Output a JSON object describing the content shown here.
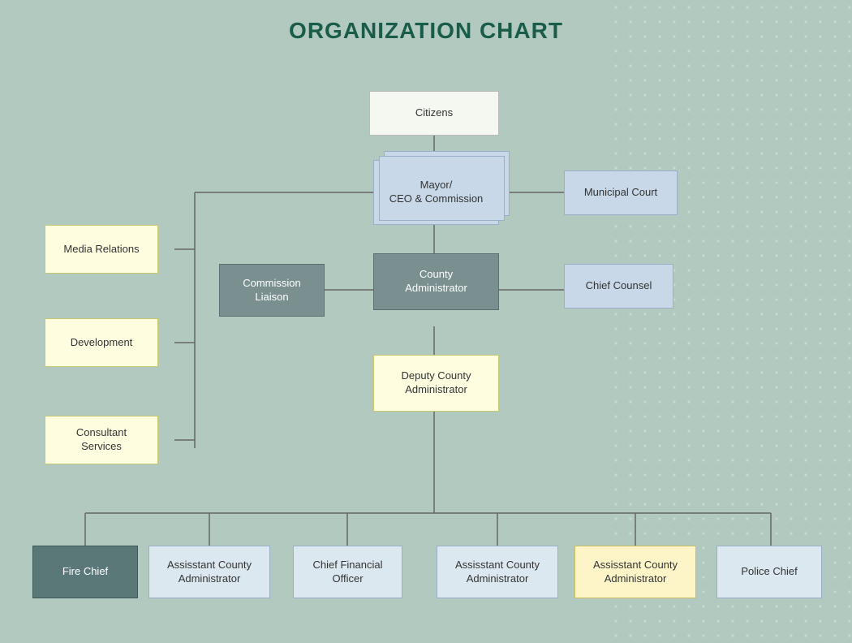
{
  "title": "ORGANIZATION CHART",
  "boxes": {
    "citizens": {
      "label": "Citizens"
    },
    "mayor": {
      "label": "Mayor/\nCEO & Commission"
    },
    "municipal_court": {
      "label": "Municipal Court"
    },
    "media_relations": {
      "label": "Media Relations"
    },
    "development": {
      "label": "Development"
    },
    "consultant_services": {
      "label": "Consultant\nServices"
    },
    "commission_liaison": {
      "label": "Commission\nLiaison"
    },
    "county_administrator": {
      "label": "County\nAdministrator"
    },
    "chief_counsel": {
      "label": "Chief Counsel"
    },
    "deputy_county_admin": {
      "label": "Deputy County\nAdministrator"
    },
    "fire_chief": {
      "label": "Fire Chief"
    },
    "asst_county_admin1": {
      "label": "Assisstant County\nAdministrator"
    },
    "cfo": {
      "label": "Chief Financial\nOfficer"
    },
    "asst_county_admin2": {
      "label": "Assisstant County\nAdministrator"
    },
    "asst_county_admin3": {
      "label": "Assisstant County\nAdministrator"
    },
    "police_chief": {
      "label": "Police Chief"
    }
  }
}
